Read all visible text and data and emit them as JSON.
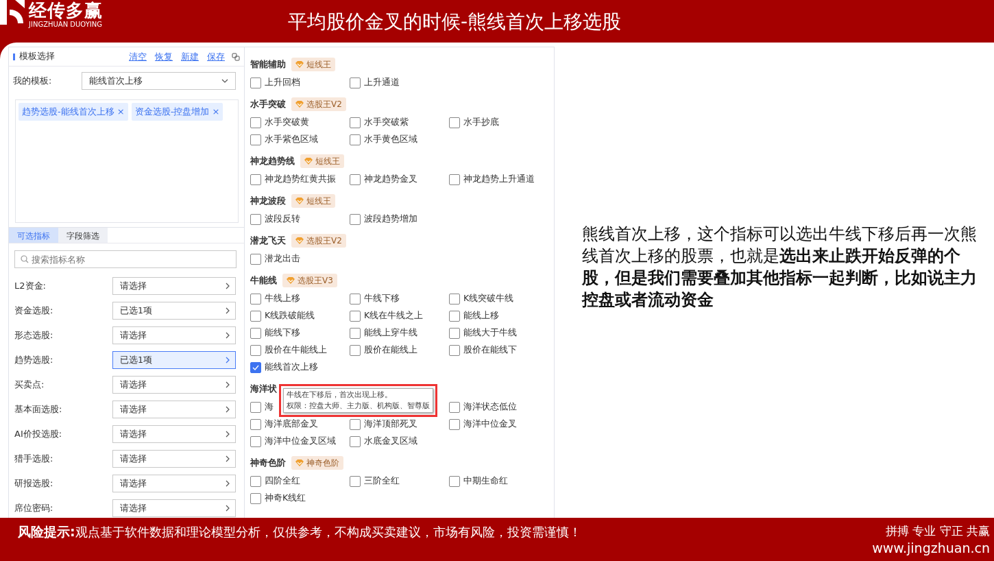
{
  "logo": {
    "name": "经传多赢",
    "subtitle": "JINGZHUAN DUOYING"
  },
  "title": "平均股价金叉的时候-熊线首次上移选股",
  "template_panel": {
    "title": "模板选择",
    "actions": [
      "清空",
      "恢复",
      "新建",
      "保存"
    ],
    "my_template_label": "我的模板:",
    "my_template_value": "能线首次上移",
    "tags": [
      {
        "label": "趋势选股-能线首次上移",
        "close": "×"
      },
      {
        "label": "资金选股-控盘增加",
        "close": "×"
      }
    ],
    "tabs": [
      {
        "label": "可选指标",
        "selected": true
      },
      {
        "label": "字段筛选",
        "selected": false
      }
    ],
    "search": {
      "placeholder": "搜索指标名称"
    },
    "filters": [
      {
        "label": "L2资金:",
        "value": "请选择",
        "selected": false
      },
      {
        "label": "资金选股:",
        "value": "已选1项",
        "selected": false
      },
      {
        "label": "形态选股:",
        "value": "请选择",
        "selected": false
      },
      {
        "label": "趋势选股:",
        "value": "已选1项",
        "selected": true
      },
      {
        "label": "买卖点:",
        "value": "请选择",
        "selected": false
      },
      {
        "label": "基本面选股:",
        "value": "请选择",
        "selected": false
      },
      {
        "label": "AI价投选股:",
        "value": "请选择",
        "selected": false
      },
      {
        "label": "猎手选股:",
        "value": "请选择",
        "selected": false
      },
      {
        "label": "研报选股:",
        "value": "请选择",
        "selected": false
      },
      {
        "label": "席位密码:",
        "value": "请选择",
        "selected": false
      }
    ]
  },
  "indicator_groups": [
    {
      "title": "智能辅助",
      "badge": "短线王",
      "rows": [
        [
          {
            "label": "上升回档",
            "checked": false
          },
          {
            "label": "上升通道",
            "checked": false
          }
        ]
      ]
    },
    {
      "title": "水手突破",
      "badge": "选股王V2",
      "rows": [
        [
          {
            "label": "水手突破黄",
            "checked": false
          },
          {
            "label": "水手突破紫",
            "checked": false
          },
          {
            "label": "水手抄底",
            "checked": false
          }
        ],
        [
          {
            "label": "水手紫色区域",
            "checked": false
          },
          {
            "label": "水手黄色区域",
            "checked": false
          }
        ]
      ]
    },
    {
      "title": "神龙趋势线",
      "badge": "短线王",
      "rows": [
        [
          {
            "label": "神龙趋势红黄共振",
            "checked": false
          },
          {
            "label": "神龙趋势金叉",
            "checked": false
          },
          {
            "label": "神龙趋势上升通道",
            "checked": false
          }
        ]
      ]
    },
    {
      "title": "神龙波段",
      "badge": "短线王",
      "rows": [
        [
          {
            "label": "波段反转",
            "checked": false
          },
          {
            "label": "波段趋势增加",
            "checked": false
          }
        ]
      ]
    },
    {
      "title": "潜龙飞天",
      "badge": "选股王V2",
      "rows": [
        [
          {
            "label": "潜龙出击",
            "checked": false
          }
        ]
      ]
    },
    {
      "title": "牛能线",
      "badge": "选股王V3",
      "rows": [
        [
          {
            "label": "牛线上移",
            "checked": false
          },
          {
            "label": "牛线下移",
            "checked": false
          },
          {
            "label": "K线突破牛线",
            "checked": false
          }
        ],
        [
          {
            "label": "K线跌破能线",
            "checked": false
          },
          {
            "label": "K线在牛线之上",
            "checked": false
          },
          {
            "label": "能线上移",
            "checked": false
          }
        ],
        [
          {
            "label": "能线下移",
            "checked": false
          },
          {
            "label": "能线上穿牛线",
            "checked": false
          },
          {
            "label": "能线大于牛线",
            "checked": false
          }
        ],
        [
          {
            "label": "股价在牛能线上",
            "checked": false
          },
          {
            "label": "股价在能线上",
            "checked": false
          },
          {
            "label": "股价在能线下",
            "checked": false
          }
        ],
        [
          {
            "label": "能线首次上移",
            "checked": true
          }
        ]
      ]
    },
    {
      "title": "海洋状",
      "rows": [
        [
          {
            "label": "海",
            "checked": false
          },
          null,
          {
            "label": "海洋状态低位",
            "checked": false
          }
        ],
        [
          {
            "label": "海洋底部金叉",
            "checked": false
          },
          {
            "label": "海洋顶部死叉",
            "checked": false
          },
          {
            "label": "海洋中位金叉",
            "checked": false
          }
        ],
        [
          {
            "label": "海洋中位金叉区域",
            "checked": false
          },
          {
            "label": "水底金叉区域",
            "checked": false
          }
        ]
      ]
    },
    {
      "title": "神奇色阶",
      "badge": "神奇色阶",
      "rows": [
        [
          {
            "label": "四阶全红",
            "checked": false
          },
          {
            "label": "三阶全红",
            "checked": false
          },
          {
            "label": "中期生命红",
            "checked": false
          }
        ],
        [
          {
            "label": "神奇K线红",
            "checked": false
          }
        ]
      ]
    }
  ],
  "tooltip": {
    "lines": [
      "牛线在下移后，首次出现上移。",
      "权限：控盘大师、主力版、机构版、智尊版"
    ]
  },
  "explanation": "熊线首次上移，这个指标可以选出牛线下移后再一次熊线首次上移的股票，也就是**选出来止跌开始反弹的个股，但是我们需要叠加其他指标一起判断，比如说主力控盘或者流动资金**",
  "footer": {
    "risk_label": "风险提示:",
    "risk_text": "观点基于软件数据和理论模型分析，仅供参考，不构成买卖建议，市场有风险，投资需谨慎！",
    "slogan": "拼搏 专业 守正 共赢",
    "website": "www.jingzhuan.cn"
  }
}
